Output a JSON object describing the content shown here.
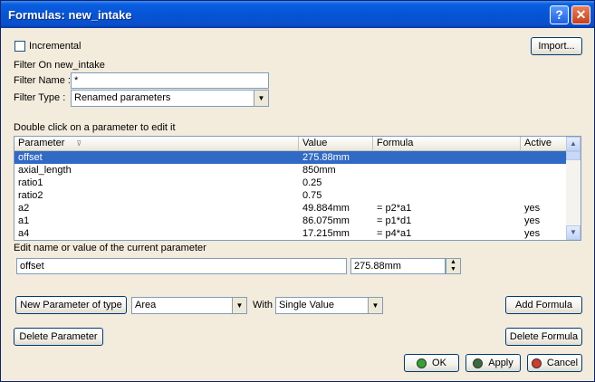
{
  "window": {
    "title": "Formulas: new_intake"
  },
  "incremental": {
    "label": "Incremental",
    "checked": false
  },
  "import_label": "Import...",
  "filter_on": "Filter On new_intake",
  "filter_name": {
    "label": "Filter Name :",
    "value": "*"
  },
  "filter_type": {
    "label": "Filter Type :",
    "value": "Renamed parameters"
  },
  "table_hint": "Double click on a parameter to edit it",
  "table": {
    "headers": [
      "Parameter",
      "Value",
      "Formula",
      "Active"
    ],
    "rows": [
      {
        "parameter": "offset",
        "value": "275.88mm",
        "formula": "",
        "active": "",
        "selected": true
      },
      {
        "parameter": "axial_length",
        "value": "850mm",
        "formula": "",
        "active": ""
      },
      {
        "parameter": "ratio1",
        "value": "0.25",
        "formula": "",
        "active": ""
      },
      {
        "parameter": "ratio2",
        "value": "0.75",
        "formula": "",
        "active": ""
      },
      {
        "parameter": "a2",
        "value": "49.884mm",
        "formula": "= p2*a1",
        "active": "yes"
      },
      {
        "parameter": "a1",
        "value": "86.075mm",
        "formula": "= p1*d1",
        "active": "yes"
      },
      {
        "parameter": "a4",
        "value": "17.215mm",
        "formula": "= p4*a1",
        "active": "yes"
      }
    ]
  },
  "edit": {
    "label": "Edit name or value of the current parameter",
    "name_value": "offset",
    "param_value": "275.88mm"
  },
  "new_param": {
    "button_label": "New Parameter of type",
    "type_value": "Area",
    "with_label": "With",
    "with_value": "Single Value"
  },
  "add_formula_label": "Add Formula",
  "delete_parameter_label": "Delete Parameter",
  "delete_formula_label": "Delete Formula",
  "ok_label": "OK",
  "apply_label": "Apply",
  "cancel_label": "Cancel"
}
